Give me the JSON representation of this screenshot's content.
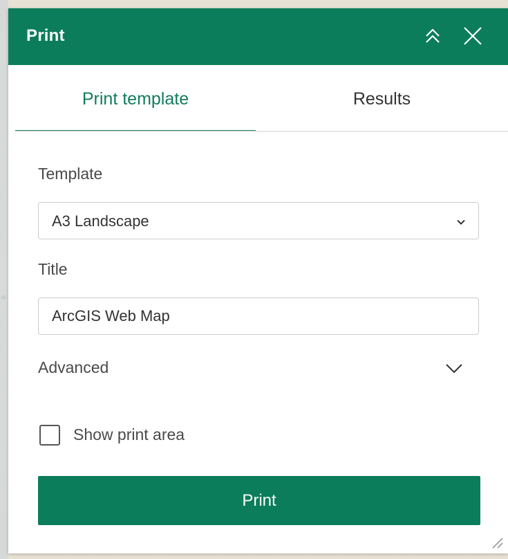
{
  "panel": {
    "title": "Print",
    "collapse_icon": "double-chevron-up-icon",
    "close_icon": "close-icon"
  },
  "tabs": [
    {
      "label": "Print template",
      "active": true
    },
    {
      "label": "Results",
      "active": false
    }
  ],
  "form": {
    "template_label": "Template",
    "template_value": "A3 Landscape",
    "title_label": "Title",
    "title_value": "ArcGIS Web Map",
    "advanced_label": "Advanced",
    "show_print_area_label": "Show print area",
    "show_print_area_checked": false
  },
  "actions": {
    "print_label": "Print"
  },
  "colors": {
    "accent": "#0b7d5a",
    "tab_active": "#127c5d",
    "text": "#4a4a4a"
  }
}
